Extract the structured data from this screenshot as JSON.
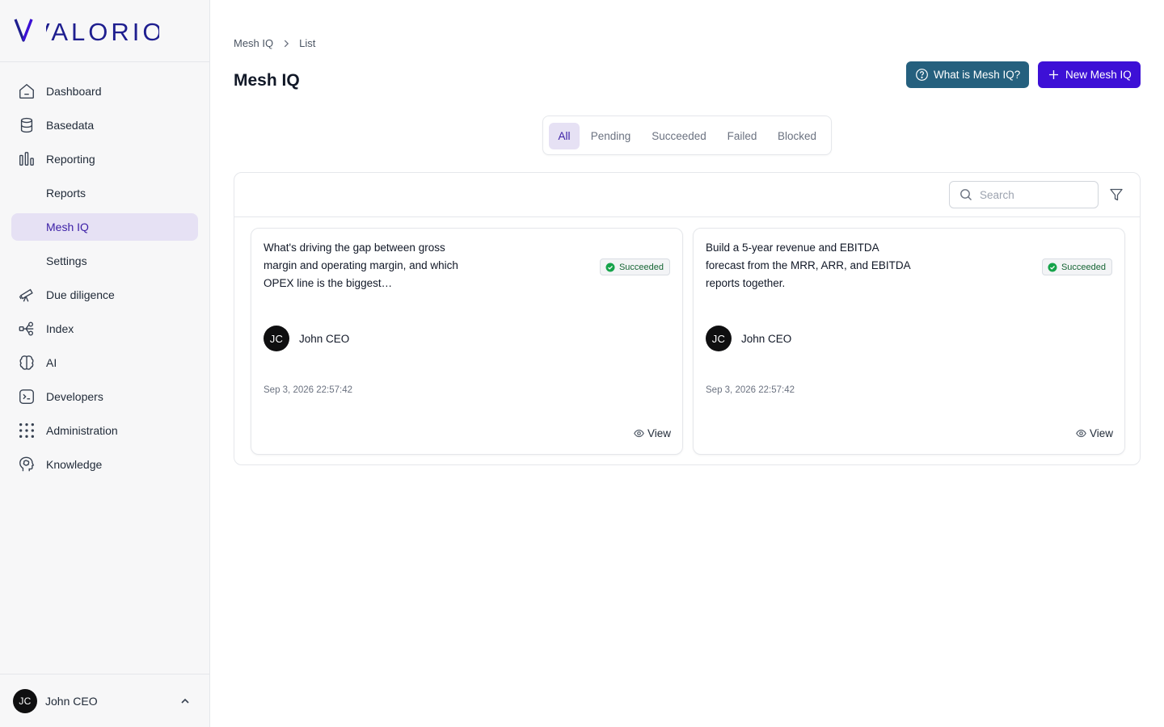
{
  "brand": {
    "logo_text": "VALORIO",
    "accent": "#3d10d6",
    "logo_v_color": "#1e1e8f"
  },
  "sidebar": {
    "items": [
      {
        "label": "Dashboard",
        "icon": "home-icon"
      },
      {
        "label": "Basedata",
        "icon": "database-icon"
      },
      {
        "label": "Reporting",
        "icon": "bar-chart-icon"
      },
      {
        "label": "Reports",
        "sub": true
      },
      {
        "label": "Mesh IQ",
        "sub": true,
        "active": true
      },
      {
        "label": "Settings",
        "sub": true
      },
      {
        "label": "Due diligence",
        "icon": "telescope-icon"
      },
      {
        "label": "Index",
        "icon": "network-icon"
      },
      {
        "label": "AI",
        "icon": "brain-icon"
      },
      {
        "label": "Developers",
        "icon": "terminal-icon"
      },
      {
        "label": "Administration",
        "icon": "grid-dots-icon"
      },
      {
        "label": "Knowledge",
        "icon": "head-brain-icon"
      }
    ],
    "user": {
      "initials": "JC",
      "name": "John CEO"
    }
  },
  "breadcrumb": {
    "root": "Mesh IQ",
    "current": "List"
  },
  "header": {
    "title": "Mesh IQ",
    "what_label": "What is Mesh IQ?",
    "new_label": "New Mesh IQ"
  },
  "tabs": [
    "All",
    "Pending",
    "Succeeded",
    "Failed",
    "Blocked"
  ],
  "toolbar": {
    "search_placeholder": "Search"
  },
  "cards": [
    {
      "question": "What's driving the gap between gross margin and operating margin, and which OPEX line is the biggest…",
      "status": "Succeeded",
      "author_initials": "JC",
      "author": "John CEO",
      "date": "Sep 3, 2026 22:57:42",
      "view_label": "View"
    },
    {
      "question": "Build a 5-year revenue and EBITDA forecast from the MRR, ARR, and EBITDA reports together.",
      "status": "Succeeded",
      "author_initials": "JC",
      "author": "John CEO",
      "date": "Sep 3, 2026 22:57:42",
      "view_label": "View"
    }
  ]
}
